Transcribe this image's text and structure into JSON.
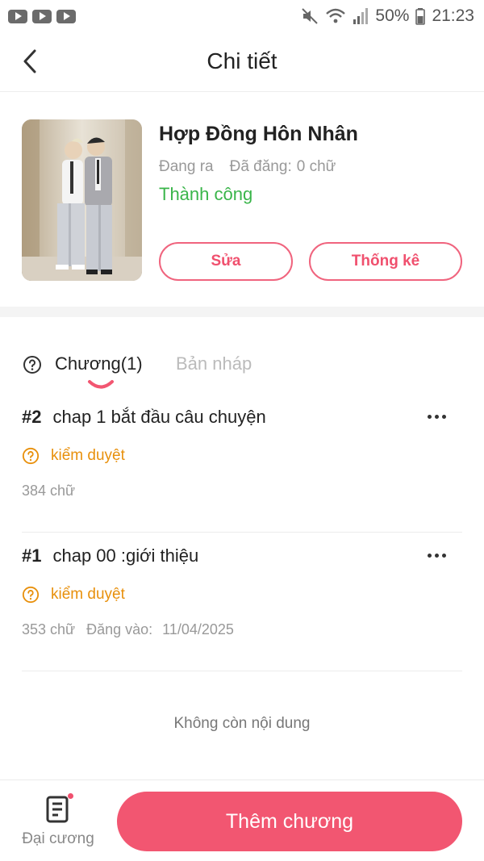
{
  "status_bar": {
    "battery": "50%",
    "time": "21:23"
  },
  "header": {
    "title": "Chi tiết"
  },
  "book": {
    "title": "Hợp Đồng Hôn Nhân",
    "state": "Đang ra",
    "posted_label": "Đã đăng:",
    "posted_value": "0 chữ",
    "review_status": "Thành công",
    "edit_label": "Sửa",
    "stats_label": "Thống kê"
  },
  "tabs": {
    "chapters": "Chương(1)",
    "drafts": "Bản nháp"
  },
  "chapters": [
    {
      "number": "#2",
      "title": "chap 1 bắt đầu câu chuyện",
      "status": "kiểm duyệt",
      "words": "384 chữ",
      "published_label": "",
      "published_date": ""
    },
    {
      "number": "#1",
      "title": "chap 00 :giới thiệu",
      "status": "kiểm duyệt",
      "words": "353 chữ",
      "published_label": "Đăng vào:",
      "published_date": "11/04/2025"
    }
  ],
  "end_message": "Không còn nội dung",
  "bottom": {
    "outline_label": "Đại cương",
    "add_chapter_label": "Thêm chương"
  },
  "colors": {
    "accent": "#f25671",
    "success": "#3ab54a",
    "warning": "#e8900c"
  }
}
